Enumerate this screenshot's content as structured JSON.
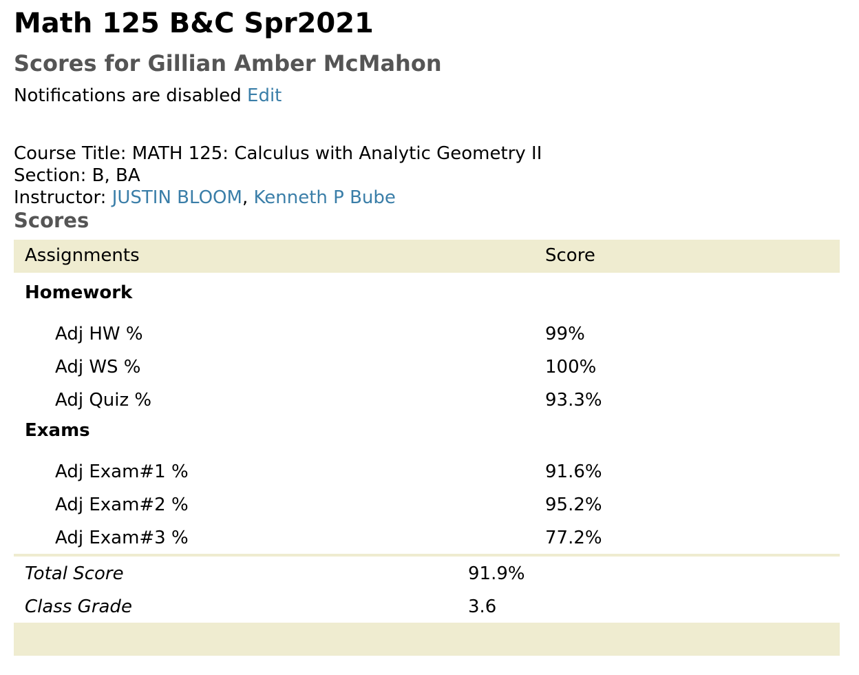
{
  "header": {
    "title": "Math 125 B&C Spr2021",
    "subtitle": "Scores for Gillian Amber McMahon",
    "notifications_text": "Notifications are disabled",
    "edit_link": "Edit"
  },
  "course": {
    "title_line": "Course Title: MATH 125: Calculus with Analytic Geometry II",
    "section_line": "Section: B, BA",
    "instructor_label": "Instructor: ",
    "instructors": [
      "JUSTIN BLOOM",
      "Kenneth P Bube"
    ],
    "instructor_separator": ", "
  },
  "scores": {
    "heading": "Scores",
    "col_assignments": "Assignments",
    "col_score": "Score",
    "groups": [
      {
        "name": "Homework",
        "items": [
          {
            "label": "Adj HW %",
            "score": "99%"
          },
          {
            "label": "Adj WS %",
            "score": "100%"
          },
          {
            "label": "Adj Quiz %",
            "score": "93.3%"
          }
        ]
      },
      {
        "name": "Exams",
        "items": [
          {
            "label": "Adj Exam#1 %",
            "score": "91.6%"
          },
          {
            "label": "Adj Exam#2 %",
            "score": "95.2%"
          },
          {
            "label": "Adj Exam#3 %",
            "score": "77.2%"
          }
        ]
      }
    ],
    "total_label": "Total Score",
    "total_value": "91.9%",
    "grade_label": "Class Grade",
    "grade_value": "3.6"
  },
  "colors": {
    "link": "#3a7ea8",
    "header_band": "#efecd0",
    "subtitle_gray": "#555555"
  }
}
